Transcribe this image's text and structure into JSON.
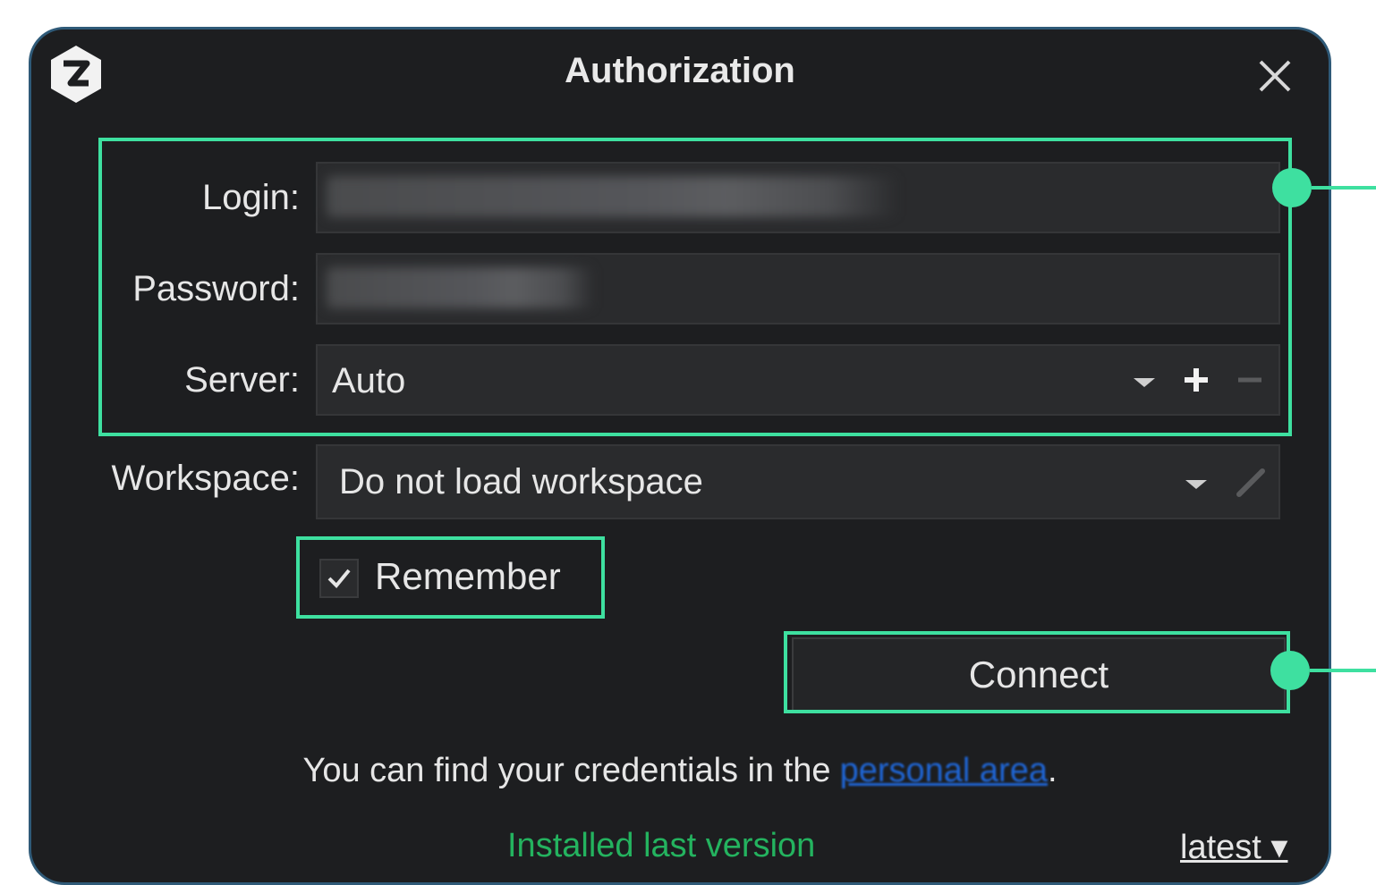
{
  "window": {
    "title": "Authorization"
  },
  "form": {
    "login_label": "Login:",
    "password_label": "Password:",
    "server_label": "Server:",
    "server_value": "Auto",
    "workspace_label": "Workspace:",
    "workspace_value": "Do not load workspace",
    "remember_label": "Remember",
    "remember_checked": "true",
    "connect_label": "Connect"
  },
  "footer": {
    "info_text": "You can find your credentials in the",
    "info_link": "personal area",
    "info_end": ".",
    "status_text": "Installed last version",
    "version_label": "latest ▾"
  },
  "colors": {
    "accent_highlight": "#3ee0a0",
    "status_green": "#24b35f",
    "link_blue": "#1f66d6",
    "window_bg": "#1d1e20"
  },
  "icons": [
    "app-logo-icon",
    "close-icon",
    "chevron-down-icon",
    "plus-icon",
    "minus-icon",
    "pencil-icon",
    "checkmark-icon"
  ]
}
